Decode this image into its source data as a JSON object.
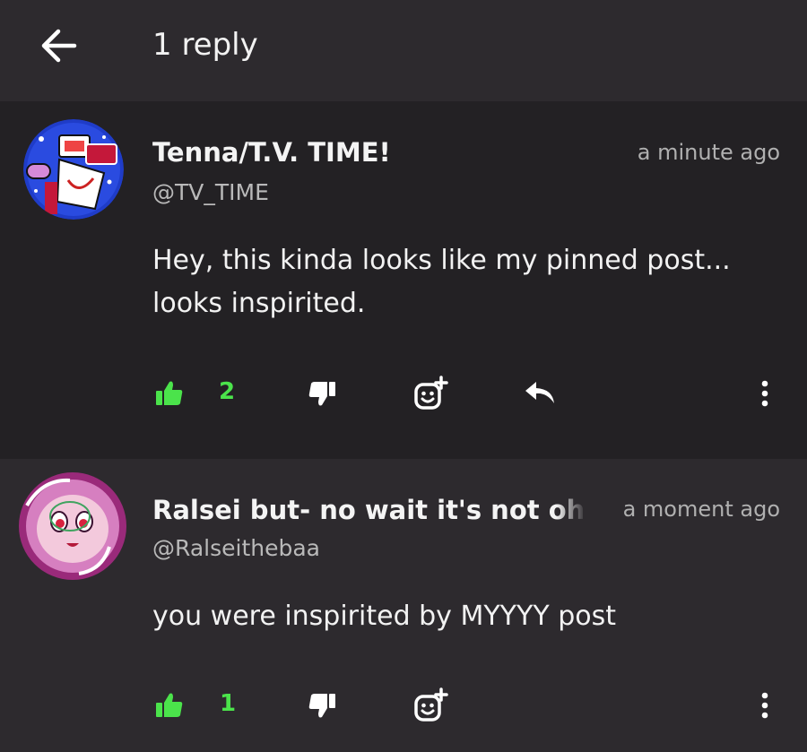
{
  "header": {
    "title": "1 reply",
    "back_icon": "arrow-left-icon"
  },
  "comments": [
    {
      "author": "Tenna/T.V. TIME!",
      "handle": "@TV_TIME",
      "timestamp": "a minute ago",
      "body_lines": [
        "Hey, this kinda looks like my pinned post...",
        "looks inspirited."
      ],
      "likes": "2",
      "avatar_icon": "tv-character-avatar"
    },
    {
      "author": "Ralsei but- no wait it's not oh",
      "handle": "@Ralseithebaa",
      "timestamp": "a moment ago",
      "body_lines": [
        "you were inspirited by MYYYY post"
      ],
      "likes": "1",
      "avatar_icon": "pink-character-avatar"
    }
  ],
  "colors": {
    "accent_like": "#4be34b",
    "background": "#232124",
    "header_bg": "#2d2a2e",
    "text": "#f2f2f2",
    "muted": "#b0b0b0"
  }
}
